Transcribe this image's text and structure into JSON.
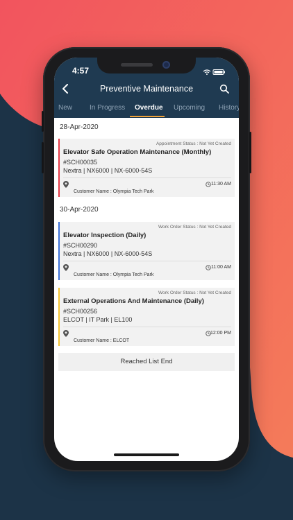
{
  "status_bar": {
    "time": "4:57"
  },
  "header": {
    "title": "Preventive Maintenance"
  },
  "tabs": [
    {
      "label": "New"
    },
    {
      "label": "In Progress"
    },
    {
      "label": "Overdue",
      "active": true
    },
    {
      "label": "Upcoming"
    },
    {
      "label": "History"
    }
  ],
  "groups": [
    {
      "date": "28-Apr-2020"
    },
    {
      "date": "30-Apr-2020"
    }
  ],
  "cards": [
    {
      "status": "Appointment Status : Not Yet Created",
      "title": "Elevator Safe Operation Maintenance (Monthly)",
      "id": "#SCH00035",
      "info": "Nextra | NX6000 | NX-6000-54S",
      "time": "11:30 AM",
      "customer": "Customer Name : Olympia Tech Park",
      "accent": "#e53945"
    },
    {
      "status": "Work Order Status : Not Yet Created",
      "title": "Elevator Inspection (Daily)",
      "id": "#SCH00290",
      "info": "Nextra | NX6000 | NX-6000-54S",
      "time": "11:00 AM",
      "customer": "Customer Name : Olympia Tech Park",
      "accent": "#3b6fd6"
    },
    {
      "status": "Work Order Status : Not Yet Created",
      "title": "External Operations And Maintenance (Daily)",
      "id": "#SCH00256",
      "info": "ELCOT | IT Park | EL100",
      "time": "12:00 PM",
      "customer": "Customer Name : ELCOT",
      "accent": "#f2c230"
    }
  ],
  "list_end": "Reached List End",
  "colors": {
    "app_bar": "#1f3a51",
    "tab_indicator": "#f0a23a",
    "background_coral": "#f0645d",
    "background_navy": "#1c3347"
  }
}
